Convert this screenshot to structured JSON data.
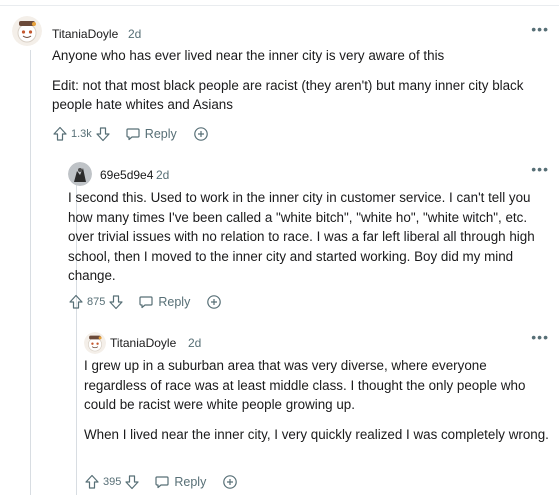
{
  "comments": [
    {
      "username": "TitaniaDoyle",
      "time": "2d",
      "paragraphs": [
        "Anyone who has ever lived near the inner city is very aware of this",
        "Edit: not that most black people are racist (they aren't) but many inner city black people hate whites and Asians"
      ],
      "score": "1.3k",
      "reply_label": "Reply",
      "more_label": "•••",
      "avatar_icon": "snoo-avatar-icon"
    },
    {
      "username": "69e5d9e4",
      "time": "2d",
      "paragraphs": [
        "I second this. Used to work in the inner city in customer service. I can't tell you how many times I've been called a \"white bitch\", \"white ho\", \"white witch\", etc. over trivial issues with no relation to race. I was a far left liberal all through high school, then I moved to the inner city and started working. Boy did my mind change."
      ],
      "score": "875",
      "reply_label": "Reply",
      "more_label": "•••",
      "avatar_icon": "user-avatar-icon"
    },
    {
      "username": "TitaniaDoyle",
      "time": "2d",
      "paragraphs": [
        "I grew up in a suburban area that was very diverse, where everyone regardless of race was at least middle class. I thought the only people who could be racist were white people growing up.",
        "When I lived near the inner city, I very quickly realized I was completely wrong."
      ],
      "score": "395",
      "reply_label": "Reply",
      "more_label": "•••",
      "avatar_icon": "snoo-avatar-icon"
    }
  ],
  "colors": {
    "text": "#1a1a1b",
    "meta": "#576f76",
    "thread_line": "#d8dde2"
  }
}
